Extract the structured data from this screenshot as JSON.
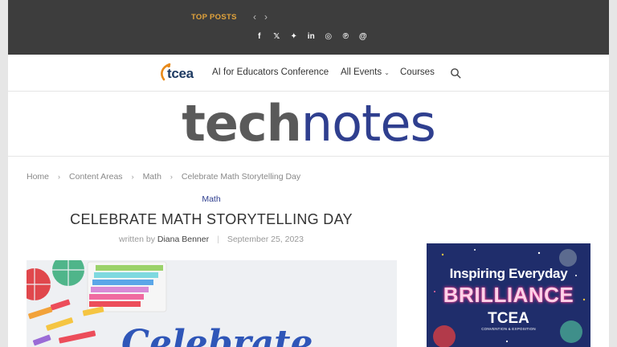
{
  "topbar": {
    "top_posts_label": "TOP POSTS",
    "prev_arrow": "‹",
    "next_arrow": "›",
    "social_icons": [
      "facebook-icon",
      "x-twitter-icon",
      "bluesky-icon",
      "linkedin-icon",
      "instagram-icon",
      "pinterest-icon",
      "threads-icon"
    ],
    "social_glyphs": [
      "f",
      "𝕏",
      "✦",
      "in",
      "◎",
      "℗",
      "@"
    ]
  },
  "nav": {
    "logo_text": "tcea",
    "items": [
      {
        "label": "AI for Educators Conference"
      },
      {
        "label": "All Events",
        "dropdown": "⌄"
      },
      {
        "label": "Courses"
      }
    ]
  },
  "masthead": {
    "part1": "tech",
    "part2": "notes"
  },
  "breadcrumb": {
    "items": [
      "Home",
      "Content Areas",
      "Math",
      "Celebrate Math Storytelling Day"
    ],
    "separator": "›"
  },
  "article": {
    "category": "Math",
    "title": "CELEBRATE MATH STORYTELLING DAY",
    "written_by": "written by",
    "author": "Diana Benner",
    "date": "September 25, 2023",
    "feature_text": "Celebrate"
  },
  "ad": {
    "line1": "Inspiring Everyday",
    "line2": "BRILLIANCE",
    "line3": "TCEA",
    "line4": "CONVENTION & EXPOSITION"
  },
  "colors": {
    "topbar_bg": "#3d3d3d",
    "top_posts": "#e2a33b",
    "brand_blue": "#2f3f8f",
    "tech_gray": "#5a5a5a",
    "ad_bg": "#1f2d6b"
  }
}
